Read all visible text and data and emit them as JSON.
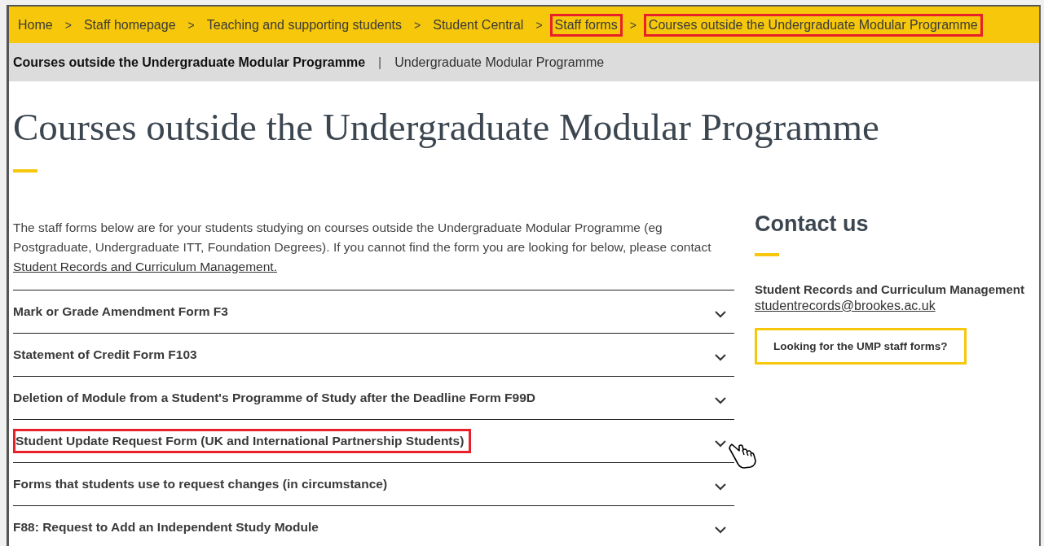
{
  "breadcrumb": [
    {
      "label": "Home",
      "highlighted": false
    },
    {
      "label": "Staff homepage",
      "highlighted": false
    },
    {
      "label": "Teaching and supporting students",
      "highlighted": false
    },
    {
      "label": "Student Central",
      "highlighted": false
    },
    {
      "label": "Staff forms",
      "highlighted": true
    },
    {
      "label": "Courses outside the Undergraduate Modular Programme",
      "highlighted": true
    }
  ],
  "breadcrumb_separator": ">",
  "subnav": {
    "items": [
      {
        "label": "Courses outside the Undergraduate Modular Programme",
        "selected": true
      },
      {
        "label": "Undergraduate Modular Programme",
        "selected": false
      }
    ],
    "separator": "|"
  },
  "page_title": "Courses outside the Undergraduate Modular Programme",
  "intro": {
    "text": "The staff forms below are for your students studying on courses outside the Undergraduate Modular Programme (eg Postgraduate, Undergraduate ITT, Foundation Degrees). If you cannot find the form you are looking for below, please contact ",
    "link": "Student Records and Curriculum Management."
  },
  "accordion": [
    {
      "title": "Mark or Grade Amendment Form F3",
      "expanded": false,
      "highlighted": false,
      "hovered": false
    },
    {
      "title": "Statement of Credit Form F103",
      "expanded": false,
      "highlighted": false,
      "hovered": false
    },
    {
      "title": "Deletion of Module from a Student's Programme of Study after the Deadline Form F99D",
      "expanded": false,
      "highlighted": false,
      "hovered": false
    },
    {
      "title": "Student Update Request Form (UK and International Partnership Students)",
      "expanded": false,
      "highlighted": true,
      "hovered": true
    },
    {
      "title": "Forms that students use to request changes (in circumstance)",
      "expanded": false,
      "highlighted": false,
      "hovered": false
    },
    {
      "title": "F88: Request to Add an Independent Study Module",
      "expanded": false,
      "highlighted": false,
      "hovered": false
    }
  ],
  "contact": {
    "heading": "Contact us",
    "name": "Student Records and Curriculum Management",
    "email": "studentrecords@brookes.ac.uk",
    "button": "Looking for the UMP staff forms?"
  }
}
